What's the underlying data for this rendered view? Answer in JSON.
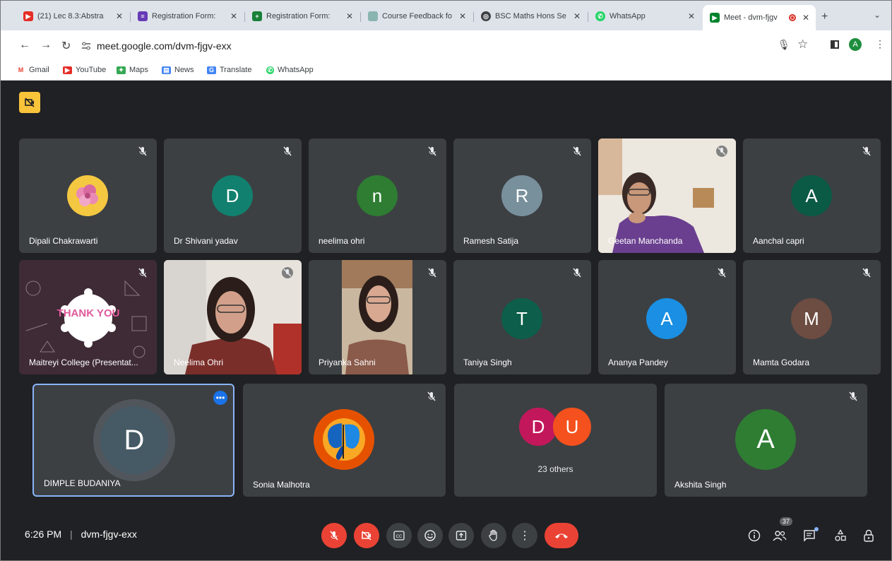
{
  "tabs": [
    {
      "title": "(21) Lec 8.3:Abstra",
      "icon": "youtube-icon",
      "color": "#e52d27"
    },
    {
      "title": "Registration Form: ",
      "icon": "forms-icon",
      "color": "#673ab7"
    },
    {
      "title": "Registration Form: ",
      "icon": "sheets-icon",
      "color": "#188038"
    },
    {
      "title": "Course Feedback fo",
      "icon": "feedback-icon",
      "color": "#8ab4b0"
    },
    {
      "title": "BSC Maths Hons Se",
      "icon": "globe-icon",
      "color": "#3c4043"
    },
    {
      "title": "WhatsApp",
      "icon": "whatsapp-icon",
      "color": "#25d366"
    },
    {
      "title": "Meet - dvm-fjgv",
      "icon": "meet-icon",
      "color": "#00832d"
    }
  ],
  "new_tab_label": "+",
  "address_bar": {
    "url": "meet.google.com/dvm-fjgv-exx"
  },
  "profile_initial": "A",
  "bookmarks": [
    {
      "label": "Gmail",
      "icon": "gmail-icon",
      "color": "#ea4335"
    },
    {
      "label": "YouTube",
      "icon": "youtube-icon",
      "color": "#e52d27"
    },
    {
      "label": "Maps",
      "icon": "maps-icon",
      "color": "#34a853"
    },
    {
      "label": "News",
      "icon": "news-icon",
      "color": "#4285f4"
    },
    {
      "label": "Translate",
      "icon": "translate-icon",
      "color": "#4285f4"
    },
    {
      "label": "WhatsApp",
      "icon": "whatsapp-icon",
      "color": "#25d366"
    }
  ],
  "participants": [
    {
      "name": "Dipali Chakrawarti",
      "initial": "",
      "color": "#f5c842"
    },
    {
      "name": "Dr Shivani yadav",
      "initial": "D",
      "color": "#12806e"
    },
    {
      "name": "neelima ohri",
      "initial": "n",
      "color": "#2e7d32"
    },
    {
      "name": "Ramesh Satija",
      "initial": "R",
      "color": "#78909c"
    },
    {
      "name": "Geetan Manchanda",
      "initial": "",
      "color": "#6a3f8f"
    },
    {
      "name": "Aanchal capri",
      "initial": "A",
      "color": "#0b5a45"
    },
    {
      "name": "Maitreyi College (Presentat...",
      "initial": "",
      "color": "#3a2a33"
    },
    {
      "name": "Neelima Ohri",
      "initial": "",
      "color": "#5a3b30"
    },
    {
      "name": "Priyanka Sahni",
      "initial": "",
      "color": "#7a4a3a"
    },
    {
      "name": "Taniya Singh",
      "initial": "T",
      "color": "#0d5e4a"
    },
    {
      "name": "Ananya Pandey",
      "initial": "A",
      "color": "#1a8fe3"
    },
    {
      "name": "Mamta Godara",
      "initial": "M",
      "color": "#6d4c41"
    },
    {
      "name": "DIMPLE BUDANIYA",
      "initial": "D",
      "color": "#455a64"
    },
    {
      "name": "Sonia Malhotra",
      "initial": "",
      "color": "#e65100"
    },
    {
      "name": "Akshita Singh",
      "initial": "A",
      "color": "#2e7d32"
    }
  ],
  "thank_you_text": "THANK YOU",
  "others": {
    "label": "23 others",
    "initials": [
      "D",
      "U"
    ],
    "colors": [
      "#c2185b",
      "#f4511e"
    ]
  },
  "meeting": {
    "time": "6:26 PM",
    "code": "dvm-fjgv-exx",
    "separator": "|"
  },
  "controls": [
    "mic-off-icon",
    "camera-off-icon",
    "captions-icon",
    "emoji-icon",
    "present-icon",
    "raise-hand-icon",
    "more-options-icon",
    "hang-up-icon"
  ],
  "people_count": "37",
  "colors": {
    "meet_bg": "#202124",
    "tile_bg": "#3c4043",
    "danger": "#ea4335",
    "accent": "#8ab4f8",
    "host_badge": "#f9c33a"
  }
}
